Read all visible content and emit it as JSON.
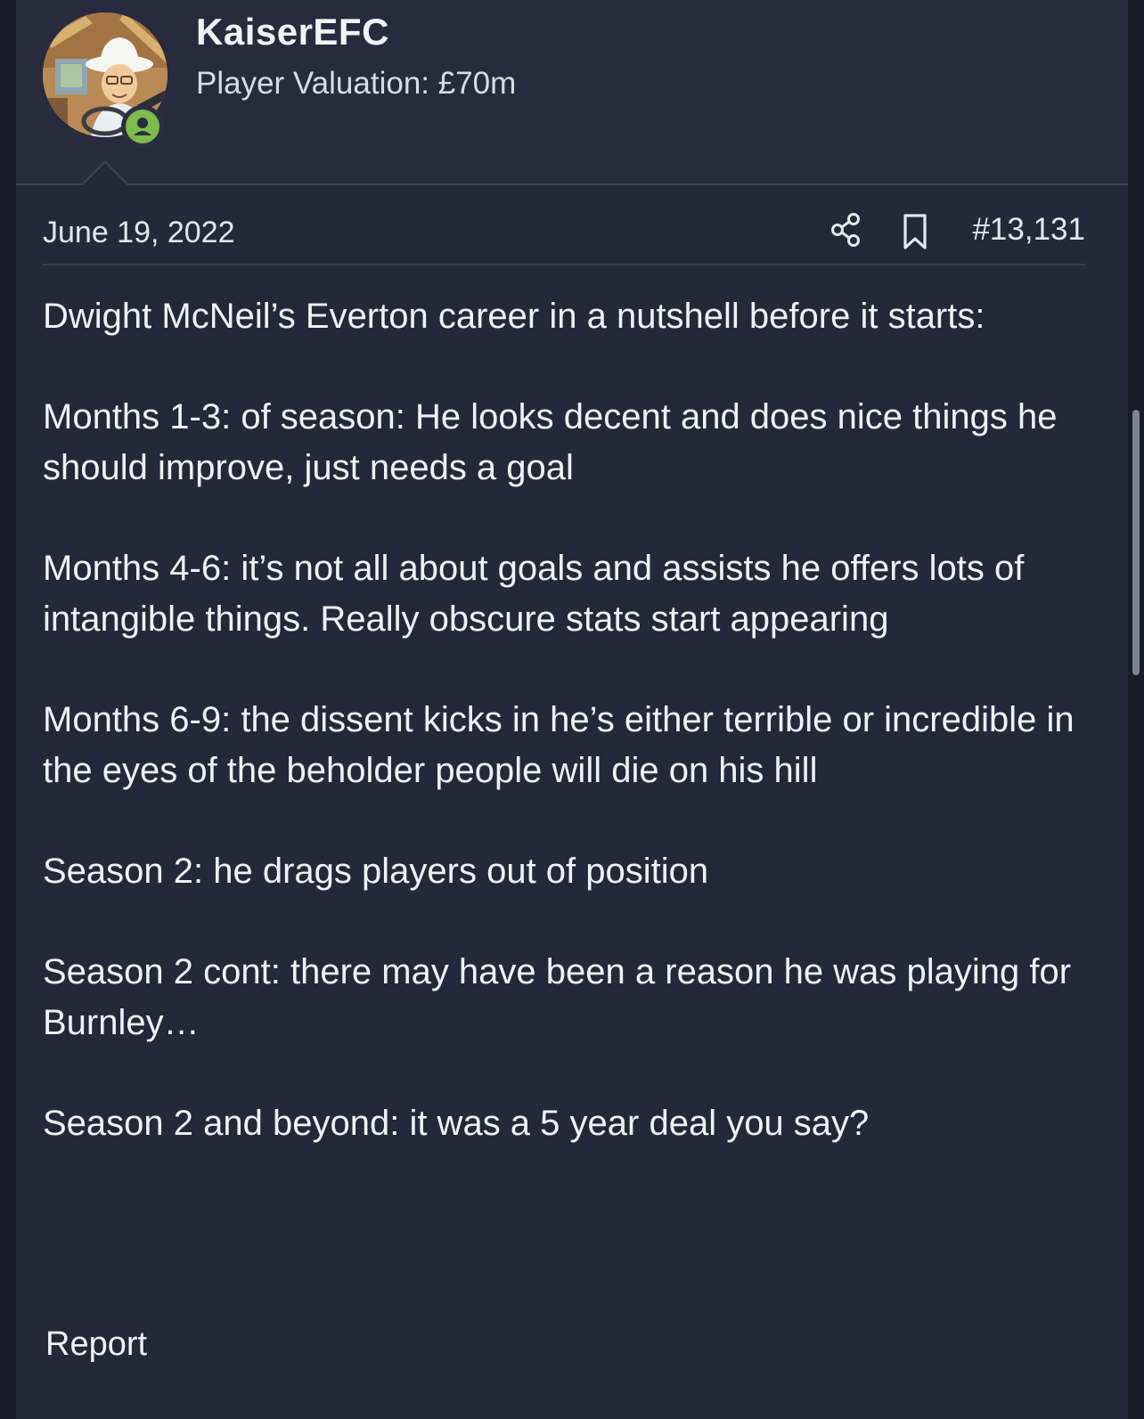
{
  "user": {
    "name": "KaiserEFC",
    "title": "Player Valuation: £70m",
    "avatar_icon": "cartoon-avatar",
    "status_icon": "online-user-icon"
  },
  "post": {
    "date": "June 19, 2022",
    "number": "#13,131",
    "share_icon": "share-icon",
    "bookmark_icon": "bookmark-icon",
    "paragraphs": [
      "Dwight McNeil’s Everton career in a nutshell before it starts:",
      "Months 1-3: of season: He looks decent and does nice things he should improve, just needs a goal",
      "Months 4-6: it’s not all about goals and assists he offers lots of intangible things. Really obscure stats start appearing",
      "Months 6-9: the dissent kicks in he’s either terrible or incredible in the eyes of the beholder people will die on his hill",
      "Season 2: he drags players out of position",
      "Season 2 cont: there may have been a reason he was playing for Burnley…",
      "Season 2 and beyond: it was a 5 year deal you say?"
    ],
    "report_label": "Report"
  },
  "colors": {
    "background": "#242838",
    "header": "#272b3d",
    "text": "#eff1f6",
    "online": "#7dbb4a"
  }
}
